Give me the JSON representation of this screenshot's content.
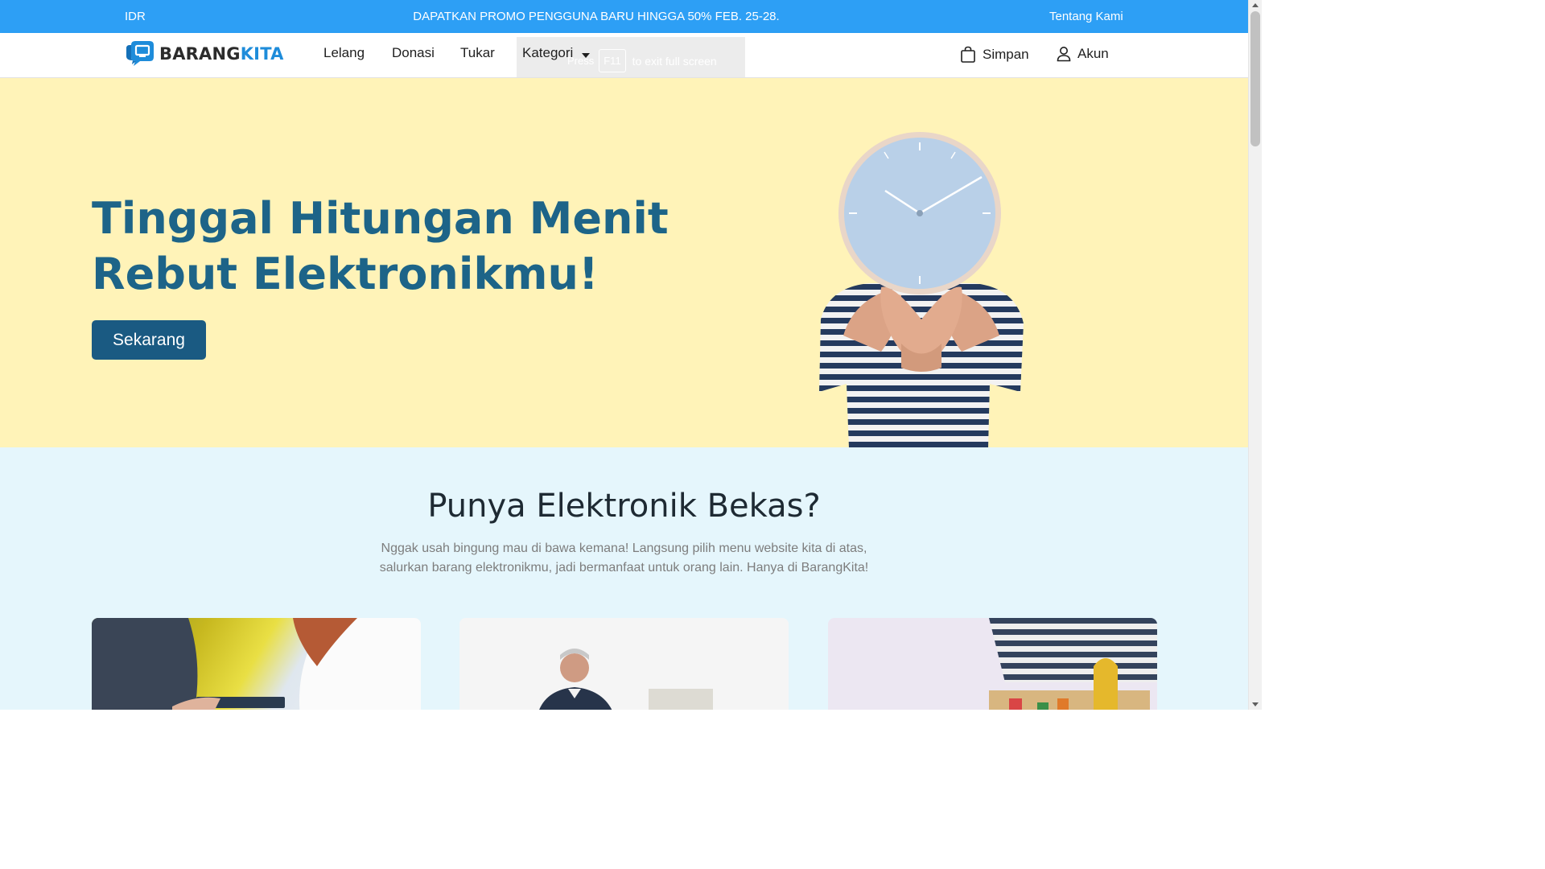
{
  "promo_bar": {
    "currency": "IDR",
    "promo_text": "DAPATKAN PROMO PENGGUNA BARU HINGGA 50% FEB. 25-28.",
    "about_link": "Tentang Kami",
    "background_color": "#2d9ff5"
  },
  "navbar": {
    "brand_part1": "BARANG",
    "brand_part2": "KITA",
    "links": [
      "Lelang",
      "Donasi",
      "Tukar"
    ],
    "dropdown_label": "Kategori",
    "fullscreen_hint": {
      "press": "Press",
      "key": "F11",
      "text": "to exit full screen"
    },
    "save_label": "Simpan",
    "account_label": "Akun"
  },
  "hero": {
    "title": "Tinggal Hitungan Menit\nRebut Elektronikmu!",
    "cta_label": "Sekarang",
    "background_color": "#fff3b8",
    "accent_color": "#1d6488"
  },
  "intro": {
    "title": "Punya Elektronik Bekas?",
    "description": "Nggak usah bingung mau di bawa kemana! Langsung pilih menu website kita di atas, salurkan barang elektronikmu, jadi bermanfaat untuk orang lain. Hanya di BarangKita!",
    "background_color": "#e5f6fc"
  }
}
